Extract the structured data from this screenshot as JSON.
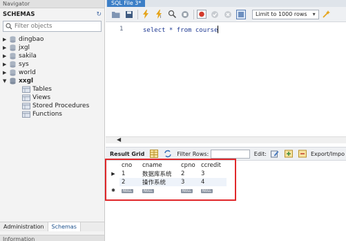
{
  "navigator": {
    "header": "Navigator",
    "schemas_title": "SCHEMAS",
    "filter_placeholder": "Filter objects",
    "schemas": [
      {
        "name": "dingbao"
      },
      {
        "name": "jxgl"
      },
      {
        "name": "sakila"
      },
      {
        "name": "sys"
      },
      {
        "name": "world"
      },
      {
        "name": "xxgl"
      }
    ],
    "xxgl_children": [
      "Tables",
      "Views",
      "Stored Procedures",
      "Functions"
    ],
    "tabs": [
      "Administration",
      "Schemas"
    ],
    "info_header": "Information"
  },
  "editor": {
    "tab_label": "SQL File 3*",
    "limit_label": "Limit to 1000 rows",
    "line_number": "1",
    "code": "select * from course"
  },
  "result": {
    "grid_label": "Result Grid",
    "filter_label": "Filter Rows:",
    "edit_label": "Edit:",
    "export_label": "Export/Impo",
    "columns": [
      "cno",
      "cname",
      "cpno",
      "ccredit"
    ],
    "rows": [
      [
        "1",
        "数据库系统",
        "2",
        "3"
      ],
      [
        "2",
        "操作系统",
        "3",
        "4"
      ]
    ],
    "null_label": "NULL"
  },
  "colors": {
    "accent_tab": "#3c7fc7",
    "highlight_border": "#e0272a",
    "sql_keyword": "#1f3a93"
  }
}
